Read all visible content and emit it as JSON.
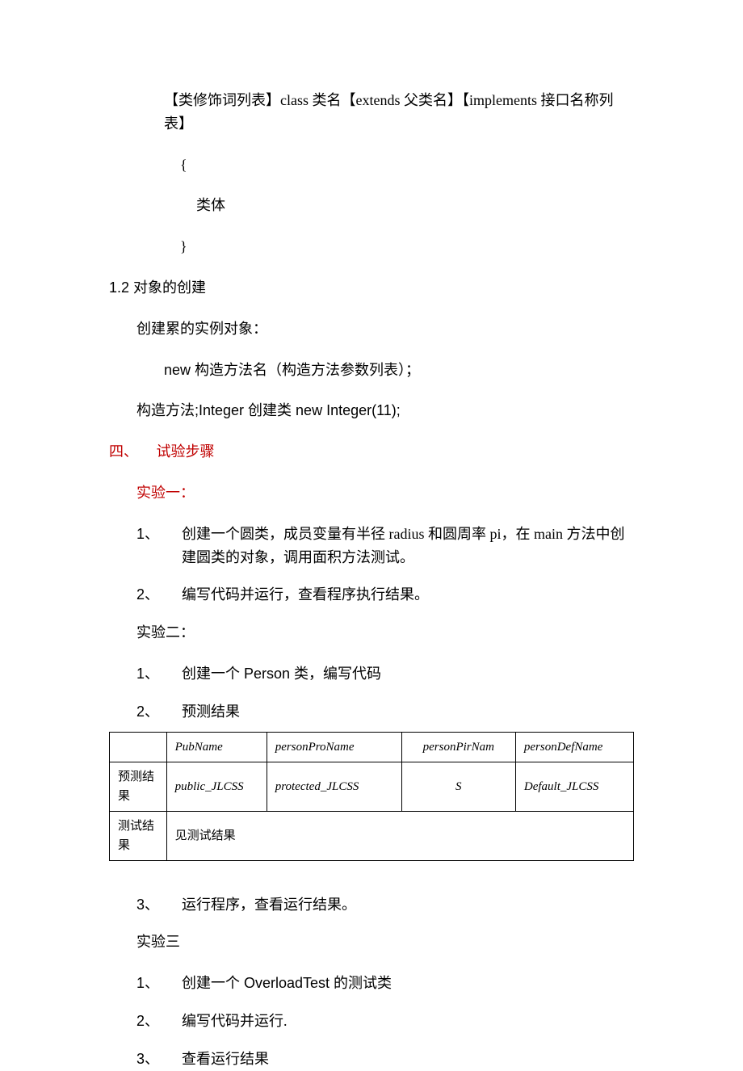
{
  "line1": "【类修饰词列表】class 类名【extends 父类名】【implements 接口名称列表】",
  "brace_open": "{",
  "class_body": "类体",
  "brace_close": "}",
  "sec12": "1.2 对象的创建",
  "sec12_p1": "创建累的实例对象：",
  "sec12_p2": "new 构造方法名（构造方法参数列表）；",
  "sec12_p3": "构造方法;Integer 创建类 new Integer(11);",
  "sec4_num": "四、",
  "sec4_title": "试验步骤",
  "exp1_title": "实验一：",
  "exp1_items": [
    {
      "n": "1、",
      "t": "创建一个圆类，成员变量有半径 radius 和圆周率 pi，在 main 方法中创建圆类的对象，调用面积方法测试。"
    },
    {
      "n": "2、",
      "t": "编写代码并运行，查看程序执行结果。"
    }
  ],
  "exp2_title": "实验二：",
  "exp2_items": [
    {
      "n": "1、",
      "t": "创建一个 Person 类，编写代码"
    },
    {
      "n": "2、",
      "t": "预测结果"
    }
  ],
  "table": {
    "headers": [
      "",
      "PubName",
      "personProName",
      "personPirNam",
      "personDefName"
    ],
    "row1": [
      "预测结果",
      "public_JLCSS",
      "protected_JLCSS",
      "S",
      "Default_JLCSS"
    ],
    "row2_label": "测试结果",
    "row2_val": "见测试结果"
  },
  "exp2_item3": {
    "n": "3、",
    "t": "运行程序，查看运行结果。"
  },
  "exp3_title": "实验三",
  "exp3_items": [
    {
      "n": "1、",
      "t": "创建一个 OverloadTest 的测试类"
    },
    {
      "n": "2、",
      "t": "编写代码并运行."
    },
    {
      "n": "3、",
      "t": "查看运行结果"
    }
  ]
}
